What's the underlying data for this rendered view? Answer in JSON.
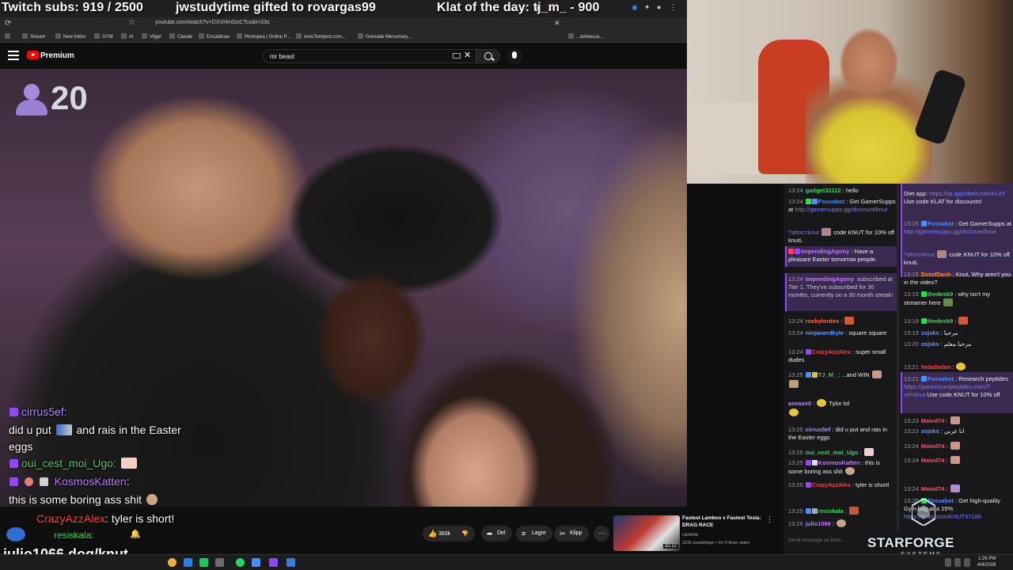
{
  "overlay_top": {
    "subs": "Twitch subs: 919 / 2500",
    "gift": "jwstudytime gifted to rovargas99",
    "klat": "Klat of the day: tj_m_ - 900"
  },
  "browser": {
    "url": "youtube.com/watch?v=DXVHmGoCTco&t=33s",
    "bookmarks": [
      "Stream",
      "New folder",
      "GYM",
      "AI",
      "Viiger",
      "Claude",
      "Excalidraw",
      "Photopea | Online P...",
      "AutoTempest.com...",
      "Grenade Mercenary..."
    ],
    "bookmark_extra": "...ambassa..."
  },
  "youtube": {
    "brand": "Premium",
    "search_value": "mr beast",
    "actions": {
      "like_count": "383k",
      "share": "Del",
      "save": "Lagre",
      "clip": "Klipp"
    },
    "recommended": {
      "title": "Fastest Lambos v Fastest Tesla: DRAG RACE",
      "channel": "carwow",
      "meta": "322k avspillinger • for 9 timer siden",
      "duration": "32:12"
    }
  },
  "video_overlay": {
    "viewer_count": "20"
  },
  "chat_overlay": [
    {
      "user": "cirrus5ef:",
      "user_color": "#b18cff",
      "text": ""
    },
    {
      "user": "",
      "text_a": "did u put",
      "text_b": "and rais in the Easter"
    },
    {
      "user": "",
      "text": "eggs"
    },
    {
      "user": "oui_cest_moi_Ugo:",
      "user_color": "#5bc46b",
      "text": ""
    },
    {
      "user": "KosmosKatten",
      "user_color": "#c07bff",
      "text": ":"
    },
    {
      "user": "",
      "text": "this is some boring ass shit"
    },
    {
      "user": "CrazyAzzAlex",
      "user_color": "#ff4040",
      "text": ": tyler is short!"
    }
  ],
  "overlay_bottom": {
    "resiskala": "resiskala:",
    "knut": "julio1066 dog/knut"
  },
  "chat": {
    "col_a": [
      {
        "t": "13:24",
        "u": "gadget32112",
        "c": "#2edb4f",
        "m": "hello"
      },
      {
        "t": "13:24",
        "u": "Fossabot",
        "c": "#4f8cff",
        "m": "Get GamerSupps at ",
        "link": "http://gamersupps.gg/discount/knut"
      },
      {
        "t": "",
        "u": "",
        "c": "#aaa",
        "m": "code KNUT for 10% off knutL",
        "pre": "?afmc=knut"
      },
      {
        "t": "13:24",
        "u": "ImpendingAgony",
        "c": "#c07bff",
        "m": "Have a pleasant Easter tomorrow people."
      },
      {
        "t": "13:24",
        "u": "ImpendingAgony",
        "c": "#c07bff",
        "m": "subscribed at Tier 1. They've subscribed for 30 months, currently on a 30 month streak!"
      },
      {
        "t": "13:24",
        "u": "rockylordes",
        "c": "#ff6a3c",
        "m": ""
      },
      {
        "t": "13:24",
        "u": "ninjanerdkyle",
        "c": "#5b9bff",
        "m": "square square"
      },
      {
        "t": "13:24",
        "u": "CrazyAzzAlex",
        "c": "#ff4040",
        "m": "super small dudes"
      },
      {
        "t": "13:25",
        "u": "TJ_M_",
        "c": "#3ec46b",
        "m": "...and WIN"
      },
      {
        "t": "",
        "u": "axeaxe0",
        "c": "#b18cff",
        "m": "Tylor lol"
      },
      {
        "t": "13:25",
        "u": "cirrus5ef",
        "c": "#b18cff",
        "m": "did u put and rais in the Easter eggs"
      },
      {
        "t": "13:25",
        "u": "oui_cest_moi_Ugo",
        "c": "#5bc46b",
        "m": ""
      },
      {
        "t": "13:25",
        "u": "KosmosKatten",
        "c": "#c07bff",
        "m": "this is some boring ass shit"
      },
      {
        "t": "13:25",
        "u": "CrazyAzzAlex",
        "c": "#ff4040",
        "m": "tyler is short!"
      },
      {
        "t": "13:25",
        "u": "resiskala",
        "c": "#2edb4f",
        "m": ""
      },
      {
        "t": "13:26",
        "u": "julio1066",
        "c": "#c07bff",
        "m": ""
      }
    ],
    "col_b": [
      {
        "t": "",
        "u": "",
        "c": "#aaa",
        "m": "Diet app:",
        "link": "https://rp.app/diet/code/KLAT",
        "after": "Use code KLAT for discounts!"
      },
      {
        "t": "13:15",
        "u": "Fossabot",
        "c": "#4f8cff",
        "m": "Get GamerSupps at ",
        "link": "http://gamersupps.gg/discount/knut"
      },
      {
        "t": "",
        "u": "",
        "c": "#aaa",
        "m": "code KNUT for 10% off knutL",
        "pre": "?afmc=knut"
      },
      {
        "t": "13:15",
        "u": "DotofDash",
        "c": "#ff8a3c",
        "m": "Knut, Why aren't you in the video?"
      },
      {
        "t": "13:15",
        "u": "thedesk9",
        "c": "#5bc46b",
        "m": "why isn't my streamer here"
      },
      {
        "t": "13:19",
        "u": "thedesk9",
        "c": "#5bc46b",
        "m": ""
      },
      {
        "t": "13:19",
        "u": "zojsks",
        "c": "#5b9bff",
        "m": "مرحبا"
      },
      {
        "t": "13:20",
        "u": "zojsks",
        "c": "#5b9bff",
        "m": "مرحبا معلم"
      },
      {
        "t": "13:21",
        "u": "fadadadan",
        "c": "#ff4040",
        "m": ""
      },
      {
        "t": "13:21",
        "u": "Fossabot",
        "c": "#4f8cff",
        "m": "Research peptides",
        "link": "https://paramountpeptides.com/?ref=knut",
        "after": "Use code KNUT for 10% off"
      },
      {
        "t": "13:23",
        "u": "Maivd74",
        "c": "#ff4f6a",
        "m": ""
      },
      {
        "t": "13:23",
        "u": "zojsks",
        "c": "#5b9bff",
        "m": "انا عربي"
      },
      {
        "t": "13:24",
        "u": "Maivd74",
        "c": "#ff4f6a",
        "m": ""
      },
      {
        "t": "13:24",
        "u": "Maivd74",
        "c": "#ff4f6a",
        "m": ""
      },
      {
        "t": "13:24",
        "u": "Maivd74",
        "c": "#ff4f6a",
        "m": ""
      },
      {
        "t": "13:25",
        "u": "Fossabot",
        "c": "#4f8cff",
        "m": "Get high-quality Gym bag at a 15%",
        "link": "https://knkg.com/KNUT37186"
      }
    ],
    "input_placeholder": "Send message as knut..."
  },
  "sponsor": {
    "name": "STARFORGE",
    "sub": "SYSTEMS"
  },
  "taskbar": {
    "time": "1:26 PM",
    "date": "4/4/2026"
  },
  "colors": {
    "twitch_purple": "#9147ff",
    "youtube_red": "#ff0000",
    "chat_bg": "#18181b"
  }
}
